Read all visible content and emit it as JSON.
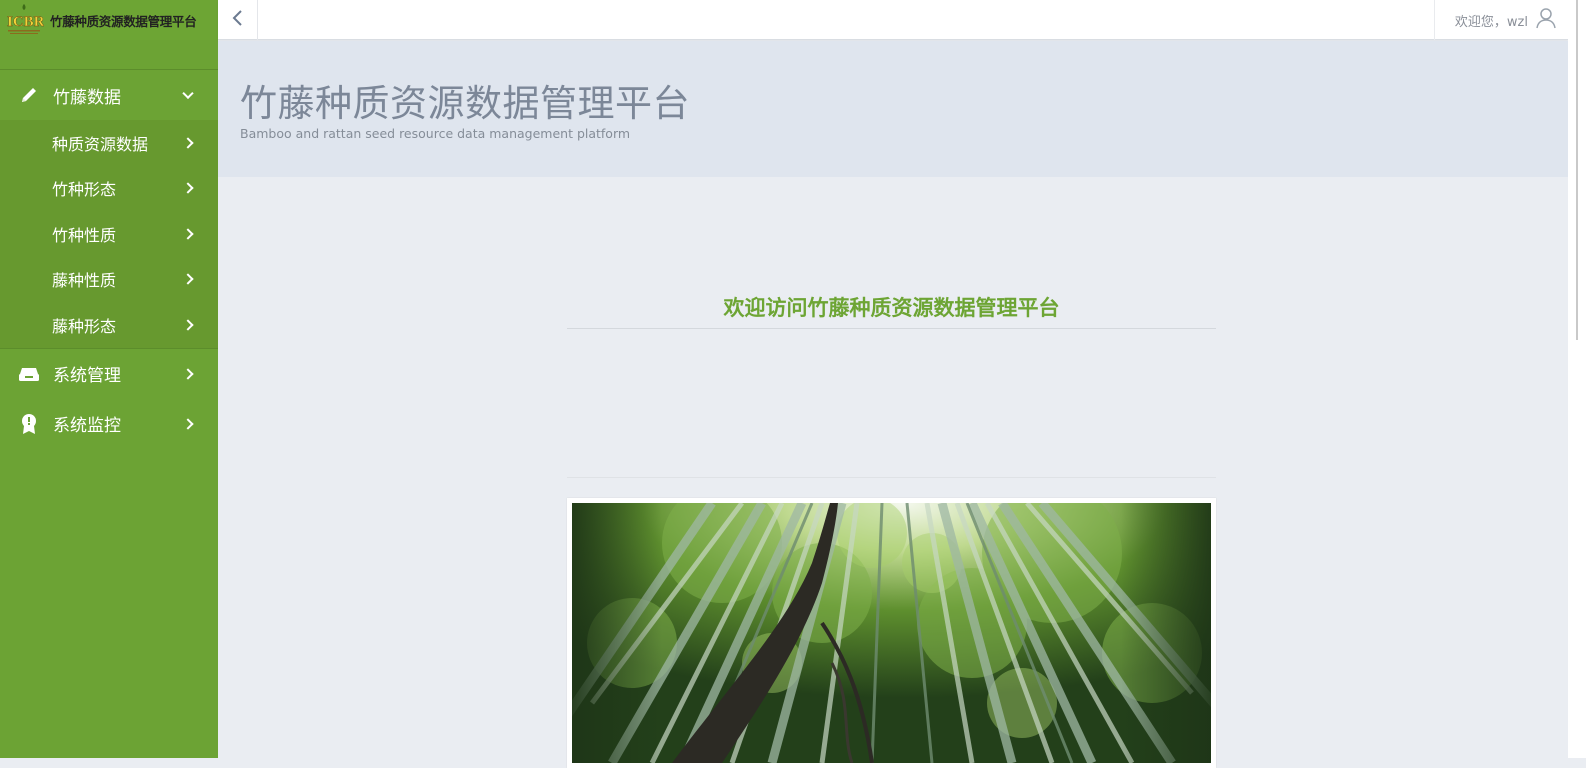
{
  "brand": {
    "logo_text": "ICBR",
    "title": "竹藤种质资源数据管理平台"
  },
  "sidebar": {
    "groups": [
      {
        "label": "竹藤数据",
        "icon": "pencil-icon",
        "expanded": true,
        "children": [
          "种质资源数据",
          "竹种形态",
          "竹种性质",
          "藤种性质",
          "藤种形态"
        ]
      },
      {
        "label": "系统管理",
        "icon": "drawer-icon",
        "expanded": false
      },
      {
        "label": "系统监控",
        "icon": "badge-icon",
        "expanded": false
      }
    ]
  },
  "topbar": {
    "welcome": "欢迎您，wzl",
    "toggle_icon": "chevron-left-icon",
    "user_icon": "user-icon"
  },
  "header": {
    "title": "竹藤种质资源数据管理平台",
    "subtitle": "Bamboo and rattan seed resource data management platform"
  },
  "main": {
    "welcome_heading": "欢迎访问竹藤种质资源数据管理平台"
  },
  "colors": {
    "sidebar": "#6ca334",
    "accent": "#6da534",
    "header_bg": "#dfe5ee",
    "page_bg": "#eaedf2"
  }
}
